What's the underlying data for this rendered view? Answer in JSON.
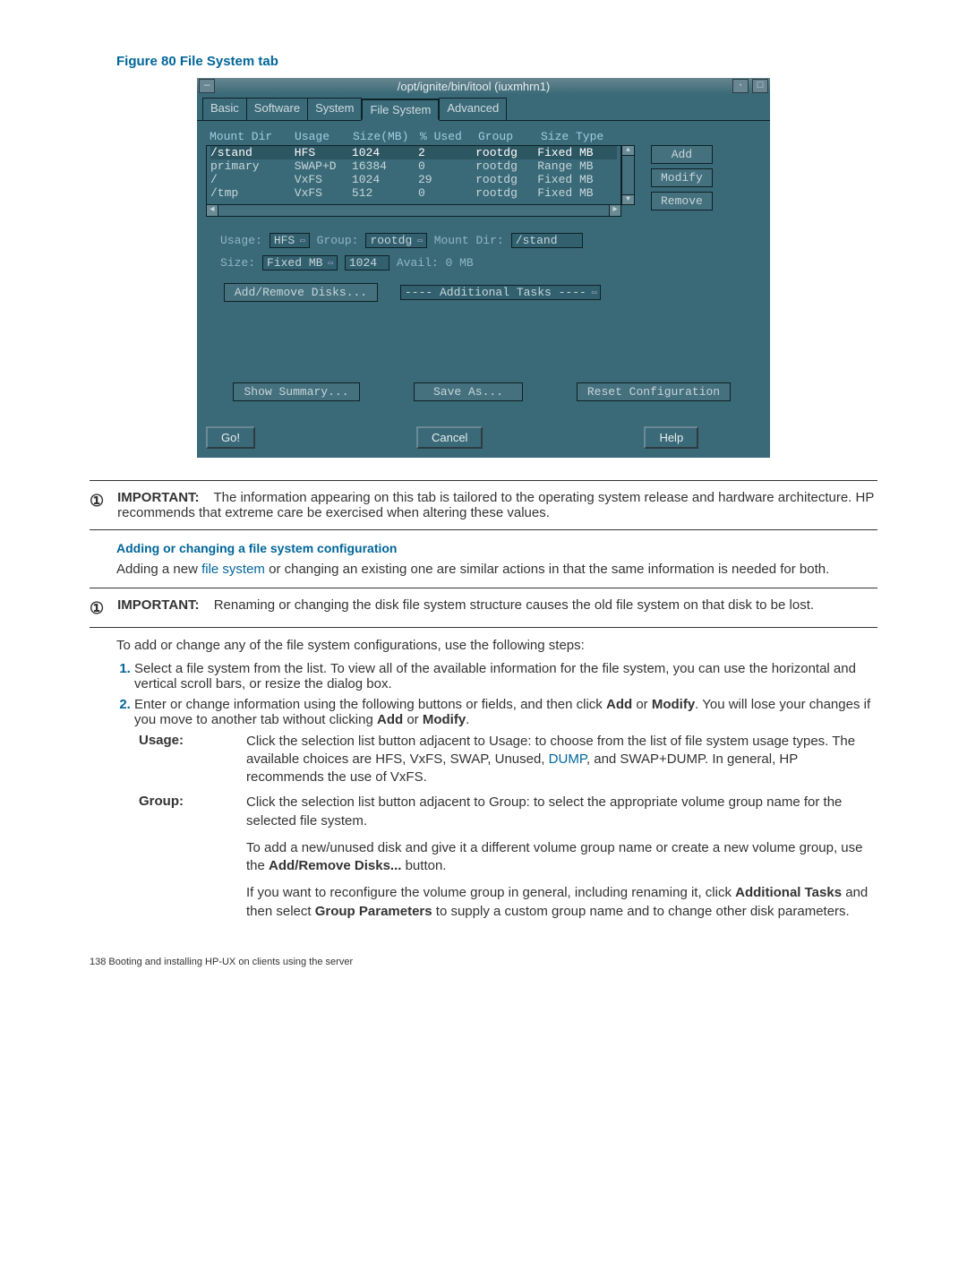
{
  "figure_caption": "Figure 80 File System tab",
  "window": {
    "title": "/opt/ignite/bin/itool (iuxmhrn1)",
    "tabs": [
      "Basic",
      "Software",
      "System",
      "File System",
      "Advanced"
    ],
    "active_tab_index": 3,
    "columns": [
      "Mount Dir",
      "Usage",
      "Size(MB)",
      "% Used",
      "Group",
      "Size Type"
    ],
    "rows": [
      {
        "dir": "/stand",
        "usage": "HFS",
        "size": "1024",
        "pct": "2",
        "group": "rootdg",
        "stype": "Fixed MB",
        "selected": true
      },
      {
        "dir": "primary",
        "usage": "SWAP+D",
        "size": "16384",
        "pct": "0",
        "group": "rootdg",
        "stype": "Range MB",
        "selected": false
      },
      {
        "dir": "/",
        "usage": "VxFS",
        "size": "1024",
        "pct": "29",
        "group": "rootdg",
        "stype": "Fixed MB",
        "selected": false
      },
      {
        "dir": "/tmp",
        "usage": "VxFS",
        "size": "512",
        "pct": "0",
        "group": "rootdg",
        "stype": "Fixed MB",
        "selected": false
      }
    ],
    "buttons": {
      "add": "Add",
      "modify": "Modify",
      "remove": "Remove"
    },
    "form": {
      "usage_label": "Usage:",
      "usage_value": "HFS",
      "group_label": "Group:",
      "group_value": "rootdg",
      "mount_label": "Mount Dir:",
      "mount_value": "/stand",
      "size_label": "Size:",
      "size_type": "Fixed MB",
      "size_value": "1024",
      "avail_label": "Avail: 0 MB"
    },
    "add_remove": "Add/Remove Disks...",
    "additional": "---- Additional Tasks ----",
    "show_summary": "Show Summary...",
    "save_as": "Save As...",
    "reset": "Reset Configuration",
    "go": "Go!",
    "cancel": "Cancel",
    "help": "Help"
  },
  "important1": "IMPORTANT:",
  "important1_text": "The information appearing on this tab is tailored to the operating system release and hardware architecture. HP recommends that extreme care be exercised when altering these values.",
  "subhead1": "Adding or changing a file system configuration",
  "para1_a": "Adding a new ",
  "para1_link": "file system",
  "para1_b": " or changing an existing one are similar actions in that the same information is needed for both.",
  "important2_text": "Renaming or changing the disk file system structure causes the old file system on that disk to be lost.",
  "para2": "To add or change any of the file system configurations, use the following steps:",
  "steps": [
    "Select a file system from the list. To view all of the available information for the file system, you can use the horizontal and vertical scroll bars, or resize the dialog box.",
    "Enter or change information using the following buttons or fields, and then click Add or Modify. You will lose your changes if you move to another tab without clicking Add or Modify."
  ],
  "step2_bold_words": [
    "Add",
    "Modify",
    "Add",
    "Modify"
  ],
  "defs": {
    "usage_label": "Usage:",
    "usage_text_a": "Click the selection list button adjacent to Usage: to choose from the list of file system usage types. The available choices are HFS, VxFS, SWAP, Unused, ",
    "usage_link": "DUMP",
    "usage_text_b": ", and SWAP+DUMP. In general, HP recommends the use of VxFS.",
    "group_label": "Group:",
    "group_p1": "Click the selection list button adjacent to Group: to select the appropriate volume group name for the selected file system.",
    "group_p2_a": "To add a new/unused disk and give it a different volume group name or create a new volume group, use the ",
    "group_p2_bold": "Add/Remove Disks...",
    "group_p2_b": " button.",
    "group_p3_a": "If you want to reconfigure the volume group in general, including renaming it, click ",
    "group_p3_bold1": "Additional Tasks",
    "group_p3_mid": " and then select ",
    "group_p3_bold2": "Group Parameters",
    "group_p3_b": " to supply a custom group name and to change other disk parameters."
  },
  "footer": "138   Booting and installing HP-UX on clients using the server"
}
